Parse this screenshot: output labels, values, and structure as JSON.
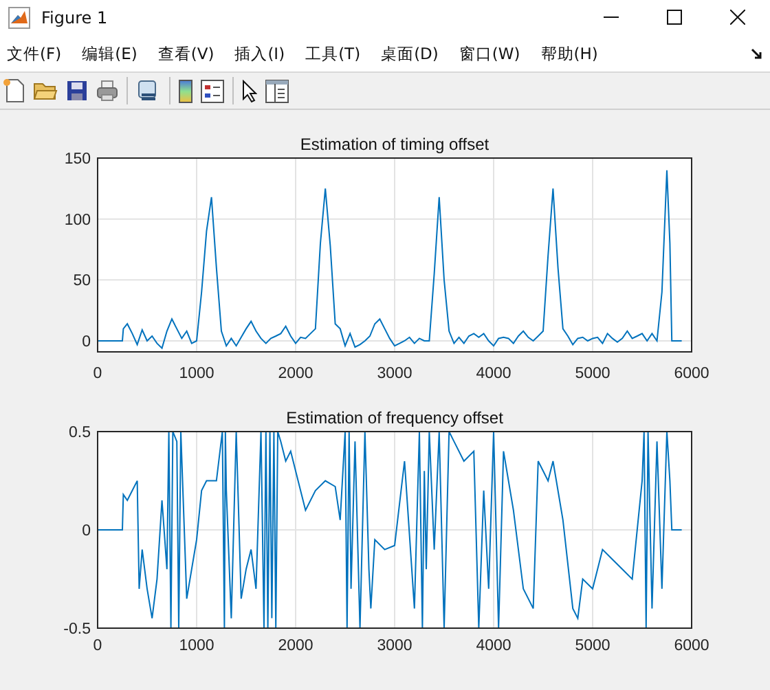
{
  "window": {
    "title": "Figure 1"
  },
  "menu": [
    "文件(F)",
    "编辑(E)",
    "查看(V)",
    "插入(I)",
    "工具(T)",
    "桌面(D)",
    "窗口(W)",
    "帮助(H)"
  ],
  "axes": [
    {
      "chart_data": {
        "type": "line",
        "grid": true,
        "title": "Estimation of timing offset",
        "xlim": [
          0,
          6000
        ],
        "ylim": [
          -9,
          150
        ],
        "xticks": [
          0,
          1000,
          2000,
          3000,
          4000,
          5000,
          6000
        ],
        "yticks": [
          0,
          50,
          100,
          150
        ],
        "x": [
          0,
          250,
          260,
          300,
          350,
          400,
          450,
          500,
          550,
          600,
          650,
          700,
          750,
          800,
          850,
          900,
          950,
          1000,
          1050,
          1100,
          1150,
          1200,
          1250,
          1300,
          1350,
          1400,
          1450,
          1500,
          1550,
          1600,
          1650,
          1700,
          1750,
          1800,
          1850,
          1900,
          1950,
          2000,
          2050,
          2100,
          2150,
          2200,
          2250,
          2300,
          2350,
          2400,
          2450,
          2500,
          2550,
          2600,
          2650,
          2700,
          2750,
          2800,
          2850,
          2900,
          2950,
          3000,
          3050,
          3100,
          3150,
          3200,
          3250,
          3300,
          3350,
          3400,
          3450,
          3500,
          3550,
          3600,
          3650,
          3700,
          3750,
          3800,
          3850,
          3900,
          3950,
          4000,
          4050,
          4100,
          4150,
          4200,
          4250,
          4300,
          4350,
          4400,
          4450,
          4500,
          4550,
          4600,
          4650,
          4700,
          4750,
          4800,
          4850,
          4900,
          4950,
          5000,
          5050,
          5100,
          5150,
          5200,
          5250,
          5300,
          5350,
          5400,
          5450,
          5500,
          5550,
          5600,
          5650,
          5700,
          5750,
          5780,
          5800,
          5900
        ],
        "series": [
          {
            "color": "#0072bd",
            "values": [
              0,
              0,
              10,
              14,
              6,
              -3,
              9,
              0,
              4,
              -2,
              -6,
              8,
              18,
              10,
              2,
              8,
              -2,
              0,
              40,
              90,
              118,
              60,
              8,
              -4,
              2,
              -4,
              3,
              10,
              16,
              8,
              2,
              -2,
              2,
              4,
              6,
              12,
              4,
              -2,
              3,
              2,
              6,
              10,
              80,
              125,
              78,
              14,
              10,
              -4,
              6,
              -5,
              -3,
              0,
              4,
              14,
              18,
              10,
              2,
              -4,
              -2,
              0,
              3,
              -2,
              2,
              0,
              0,
              55,
              118,
              50,
              8,
              -2,
              3,
              -2,
              4,
              6,
              3,
              6,
              0,
              -4,
              2,
              3,
              2,
              -2,
              4,
              8,
              3,
              0,
              4,
              8,
              70,
              125,
              60,
              10,
              4,
              -3,
              2,
              3,
              0,
              2,
              3,
              -2,
              6,
              2,
              -1,
              2,
              8,
              2,
              4,
              6,
              0,
              6,
              0,
              40,
              140,
              80,
              0,
              0
            ]
          }
        ]
      }
    },
    {
      "chart_data": {
        "type": "line",
        "grid": true,
        "title": "Estimation of frequency offset",
        "xlim": [
          0,
          6000
        ],
        "ylim": [
          -0.5,
          0.5
        ],
        "xticks": [
          0,
          1000,
          2000,
          3000,
          4000,
          5000,
          6000
        ],
        "yticks": [
          -0.5,
          0,
          0.5
        ],
        "x": [
          0,
          250,
          260,
          300,
          350,
          400,
          420,
          450,
          500,
          550,
          600,
          650,
          700,
          720,
          740,
          760,
          800,
          820,
          840,
          900,
          1000,
          1050,
          1100,
          1200,
          1260,
          1280,
          1290,
          1300,
          1350,
          1400,
          1450,
          1500,
          1550,
          1600,
          1650,
          1680,
          1700,
          1720,
          1740,
          1760,
          1780,
          1800,
          1820,
          1850,
          1900,
          1950,
          2000,
          2100,
          2200,
          2300,
          2400,
          2450,
          2500,
          2520,
          2540,
          2560,
          2600,
          2650,
          2700,
          2740,
          2760,
          2800,
          2900,
          3000,
          3100,
          3200,
          3250,
          3280,
          3300,
          3320,
          3350,
          3400,
          3450,
          3500,
          3550,
          3600,
          3700,
          3800,
          3850,
          3900,
          3950,
          4000,
          4050,
          4100,
          4200,
          4300,
          4400,
          4450,
          4500,
          4550,
          4600,
          4700,
          4800,
          4850,
          4900,
          5000,
          5100,
          5200,
          5300,
          5400,
          5500,
          5520,
          5540,
          5560,
          5600,
          5650,
          5700,
          5750,
          5780,
          5800,
          5900
        ],
        "series": [
          {
            "color": "#0072bd",
            "values": [
              0,
              0,
              0.18,
              0.15,
              0.2,
              0.25,
              -0.3,
              -0.1,
              -0.3,
              -0.45,
              -0.25,
              0.15,
              -0.2,
              0.5,
              -0.5,
              0.5,
              0.45,
              -0.5,
              0.5,
              -0.35,
              -0.05,
              0.2,
              0.25,
              0.25,
              0.5,
              -0.5,
              0.5,
              0.2,
              -0.45,
              0.5,
              -0.35,
              -0.2,
              -0.1,
              -0.3,
              0.5,
              -0.5,
              0.5,
              -0.5,
              0.5,
              -0.45,
              0.5,
              -0.5,
              0.5,
              0.45,
              0.35,
              0.4,
              0.3,
              0.1,
              0.2,
              0.25,
              0.22,
              0.05,
              0.5,
              -0.5,
              0.5,
              -0.3,
              0.45,
              -0.5,
              0.5,
              -0.2,
              -0.4,
              -0.05,
              -0.1,
              -0.08,
              0.35,
              -0.4,
              0.5,
              -0.5,
              0.3,
              -0.2,
              0.5,
              -0.1,
              0.5,
              -0.5,
              0.5,
              0.45,
              0.35,
              0.4,
              -0.5,
              0.2,
              -0.3,
              0.5,
              -0.5,
              0.4,
              0.1,
              -0.3,
              -0.4,
              0.35,
              0.3,
              0.25,
              0.35,
              0.05,
              -0.4,
              -0.45,
              -0.25,
              -0.3,
              -0.1,
              -0.15,
              -0.2,
              -0.25,
              0.25,
              0.5,
              -0.5,
              0.5,
              -0.4,
              0.45,
              -0.3,
              0.5,
              0.25,
              0,
              0
            ]
          }
        ]
      }
    }
  ]
}
